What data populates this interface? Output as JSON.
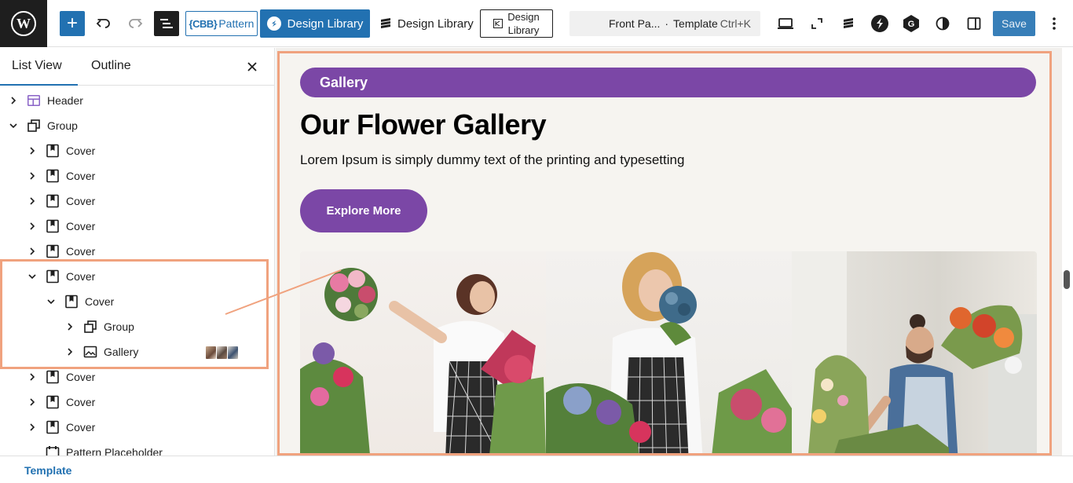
{
  "toolbar": {
    "add_label": "+",
    "cbb_mark": "{CBB}",
    "cbb_label": "Pattern",
    "design_library_blue": "Design Library",
    "design_library_plain": "Design Library",
    "design_library_box_line1": "Design",
    "design_library_box_line2": "Library",
    "command": {
      "title": "Front Pa...",
      "separator": "·",
      "type": "Template",
      "shortcut": "Ctrl+K"
    },
    "save_label": "Save"
  },
  "sidebar": {
    "tabs": [
      {
        "label": "List View",
        "active": true
      },
      {
        "label": "Outline",
        "active": false
      }
    ],
    "tree": [
      {
        "label": "Header",
        "icon": "header-icon",
        "expanded": false
      },
      {
        "label": "Group",
        "icon": "group-icon",
        "expanded": true
      },
      {
        "label": "Cover",
        "icon": "cover-icon",
        "expanded": false
      },
      {
        "label": "Cover",
        "icon": "cover-icon",
        "expanded": false
      },
      {
        "label": "Cover",
        "icon": "cover-icon",
        "expanded": false
      },
      {
        "label": "Cover",
        "icon": "cover-icon",
        "expanded": false
      },
      {
        "label": "Cover",
        "icon": "cover-icon",
        "expanded": false
      },
      {
        "label": "Cover",
        "icon": "cover-icon",
        "expanded": true
      },
      {
        "label": "Cover",
        "icon": "cover-icon",
        "expanded": true
      },
      {
        "label": "Group",
        "icon": "group-icon",
        "expanded": false
      },
      {
        "label": "Gallery",
        "icon": "gallery-icon",
        "expanded": false
      },
      {
        "label": "Cover",
        "icon": "cover-icon",
        "expanded": false
      },
      {
        "label": "Cover",
        "icon": "cover-icon",
        "expanded": false
      },
      {
        "label": "Cover",
        "icon": "cover-icon",
        "expanded": false
      },
      {
        "label": "Pattern Placeholder",
        "icon": "pattern-placeholder-icon",
        "expanded": false
      }
    ]
  },
  "canvas": {
    "pill_label": "Gallery",
    "title": "Our Flower Gallery",
    "subtitle": "Lorem Ipsum is simply dummy text of the printing and typesetting",
    "button_label": "Explore More"
  },
  "footer": {
    "breadcrumb": "Template"
  },
  "colors": {
    "wp_blue": "#2271b1",
    "accent_purple": "#7b47a6",
    "highlight_orange": "#f0a27e"
  }
}
